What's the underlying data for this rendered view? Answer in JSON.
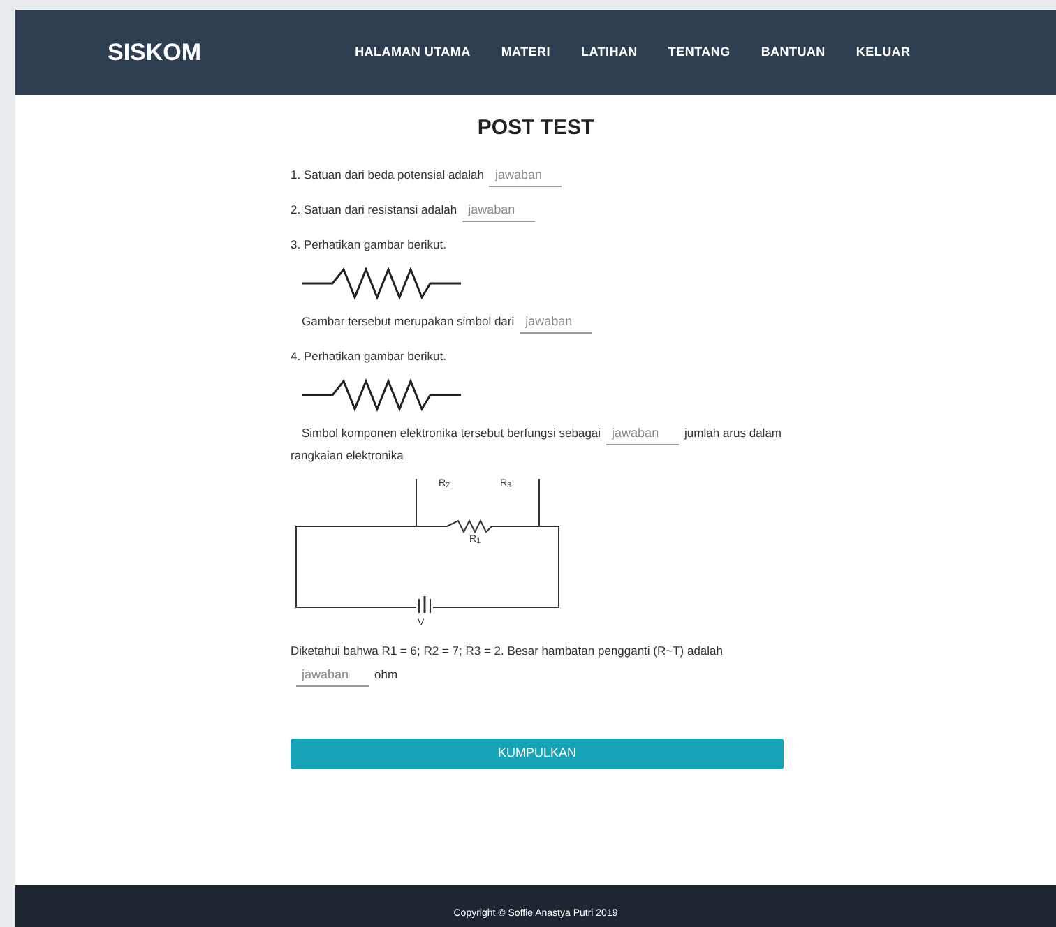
{
  "brand": "SISKOM",
  "nav": [
    {
      "label": "HALAMAN UTAMA"
    },
    {
      "label": "MATERI"
    },
    {
      "label": "LATIHAN"
    },
    {
      "label": "TENTANG"
    },
    {
      "label": "BANTUAN"
    },
    {
      "label": "KELUAR"
    }
  ],
  "title": "POST TEST",
  "items": [
    {
      "kind": "blank",
      "before": "1. Satuan dari beda potensial adalah",
      "placeholder": "jawaban"
    },
    {
      "kind": "blank",
      "before": "2. Satuan dari resistansi adalah",
      "placeholder": "jawaban"
    },
    {
      "kind": "text",
      "text": "3. Perhatikan gambar berikut."
    },
    {
      "kind": "resistor"
    },
    {
      "kind": "sub",
      "before": "Gambar tersebut merupakan simbol dari",
      "placeholder": "jawaban"
    },
    {
      "kind": "text",
      "text": "4. Perhatikan gambar berikut."
    },
    {
      "kind": "resistor"
    },
    {
      "kind": "sub",
      "before": "Simbol komponen elektronika tersebut berfungsi sebagai",
      "placeholder": "jawaban",
      "after": "jumlah arus dalam rangkaian elektronika"
    },
    {
      "kind": "circuit",
      "labels": [
        "R$_{2}$",
        "R$_{3}$",
        "R$_{1}$",
        "V"
      ]
    },
    {
      "kind": "text",
      "text": "Diketahui bahwa R1 = 6; R2 = 7; R3 = 2. Besar hambatan pengganti (R~T) adalah"
    },
    {
      "kind": "blank",
      "placeholder": "jawaban",
      "after": "ohm"
    }
  ],
  "submit": "KUMPULKAN",
  "footer": "Copyright © Soffie Anastya Putri 2019"
}
